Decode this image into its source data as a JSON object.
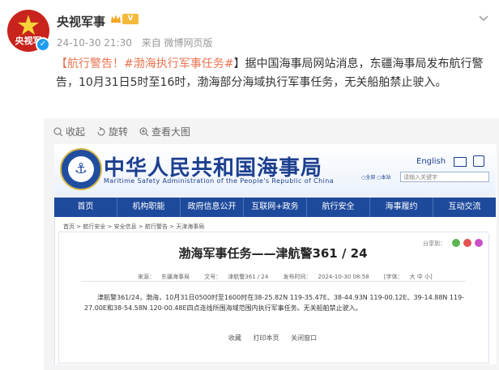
{
  "post": {
    "author": "央视军事",
    "avatar_text": "央视军",
    "time": "24-10-30 21:30",
    "source": "来自 微博网页版",
    "text_prefix": "【航行警告！",
    "hashtag": "#渤海执行军事任务#",
    "text_body": "】据中国海事局网站消息，东疆海事局发布航行警告，10月31日5时至16时，渤海部分海域执行军事任务，无关船舶禁止驶入。"
  },
  "media_toolbar": {
    "collect": "收起",
    "rotate": "旋转",
    "view_large": "查看大图"
  },
  "site": {
    "title": "中华人民共和国海事局",
    "subtitle": "Maritime Safety Administration of the People's Republic of China",
    "emblem_text": "CHINA MSA",
    "english": "English",
    "search_placeholder": "请输入关键字",
    "radio_opts": "○全部 ○本站",
    "nav": [
      "首页",
      "机构职能",
      "政府信息公开",
      "互联网+政务",
      "航行安全",
      "海事履约",
      "互动交流"
    ]
  },
  "breadcrumb": "首页 > 航行安全 > 安全信息 > 航行警告 > 天津海事局",
  "article": {
    "title": "渤海军事任务——津航警361 / 24",
    "share_label": "分享到：",
    "source_label": "来源：",
    "source": "东疆海事局",
    "number_label": "文号：",
    "number": "津航警361 / 24",
    "published_label": "发布时间：",
    "published": "2024-10-30 08:58",
    "font_label": "[字体：",
    "font_opts": "大  中  小]",
    "body": "津航警361/24，渤海，10月31日0500时至1600时在38-25.82N 119-35.47E、38-44.93N 119-00.12E、39-14.88N 119-27.00E和38-54.58N 120-00.48E四点连线所围海域范围内执行军事任务。无关船舶禁止驶入。",
    "actions": [
      "收藏",
      "打印本页",
      "关闭窗口"
    ]
  },
  "colors": {
    "accent": "#eb7350",
    "nav_bg": "#1e4a9c",
    "title_blue": "#1c3f8f"
  }
}
